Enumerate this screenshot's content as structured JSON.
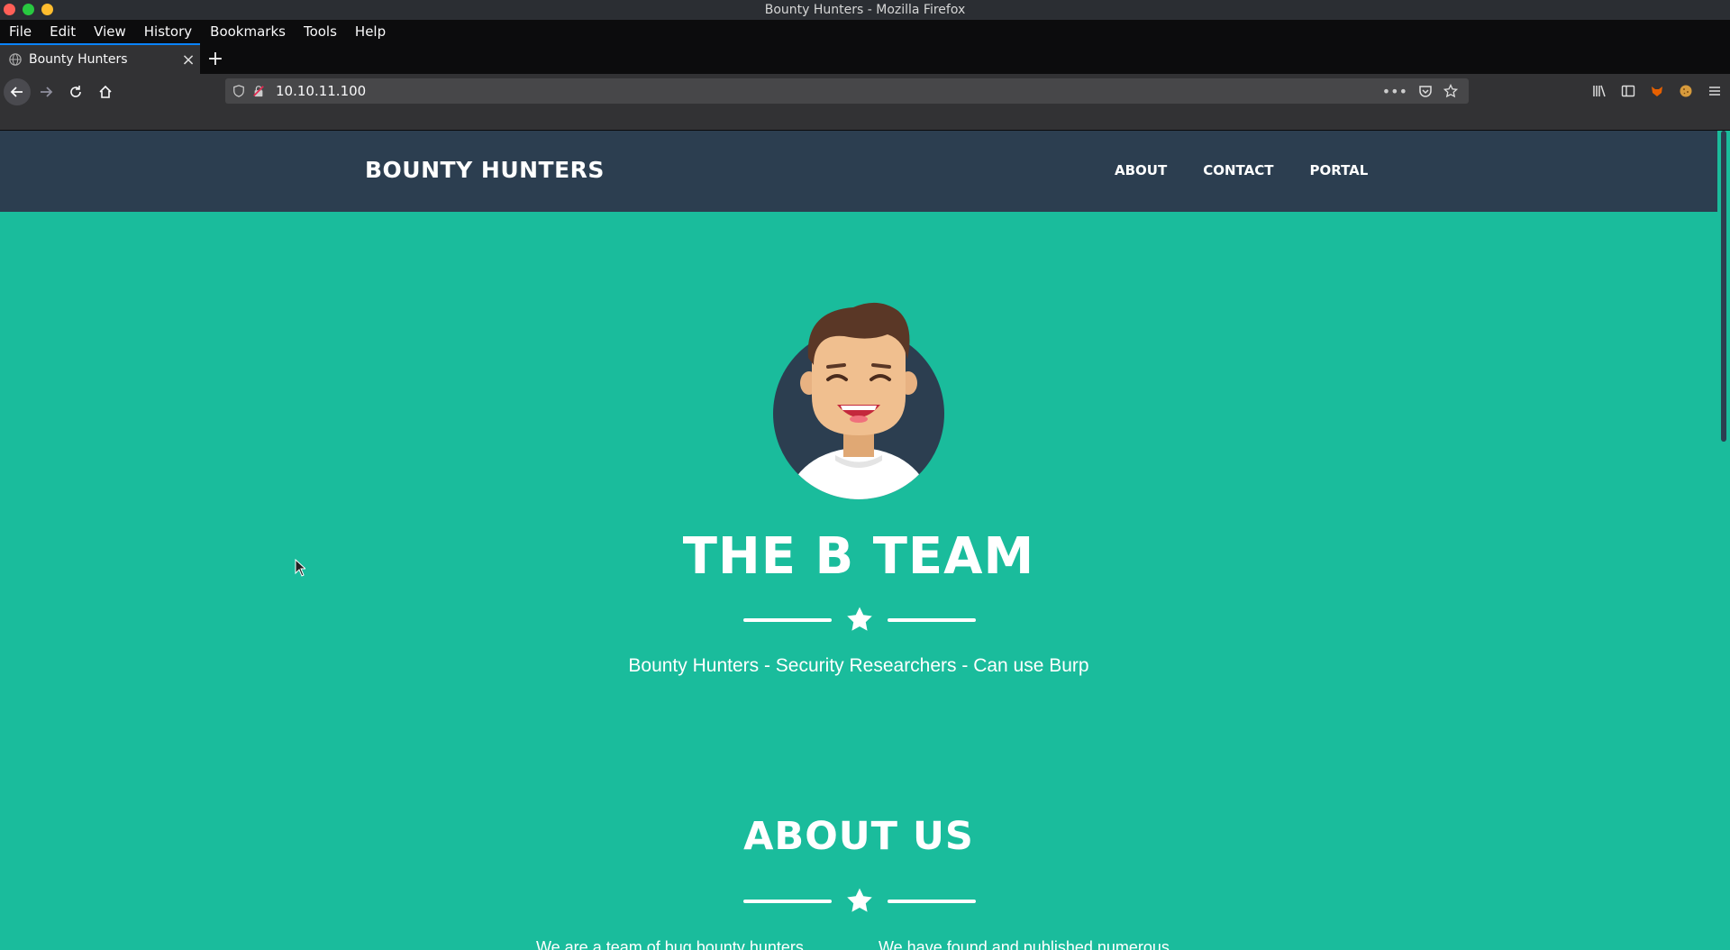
{
  "window": {
    "title": "Bounty Hunters - Mozilla Firefox",
    "controls": [
      {
        "name": "close",
        "color": "#ff5f57"
      },
      {
        "name": "minimize",
        "color": "#28c940"
      },
      {
        "name": "maximize",
        "color": "#ffbd2e"
      }
    ]
  },
  "menubar": {
    "items": [
      "File",
      "Edit",
      "View",
      "History",
      "Bookmarks",
      "Tools",
      "Help"
    ]
  },
  "tabs": [
    {
      "title": "Bounty Hunters",
      "icon": "globe-icon"
    }
  ],
  "newtab_label": "+",
  "urlbar": {
    "url": "10.10.11.100"
  },
  "site": {
    "brand": "BOUNTY HUNTERS",
    "nav": [
      "ABOUT",
      "CONTACT",
      "PORTAL"
    ],
    "hero_title": "THE B TEAM",
    "hero_subtitle": "Bounty Hunters - Security Researchers - Can use Burp",
    "about_title": "ABOUT US",
    "about_col1": "We are a team of bug bounty hunters",
    "about_col2": "We have found and published numerous",
    "colors": {
      "accent": "#1abc9c",
      "nav_bg": "#2c3e50",
      "text": "#ffffff"
    }
  }
}
